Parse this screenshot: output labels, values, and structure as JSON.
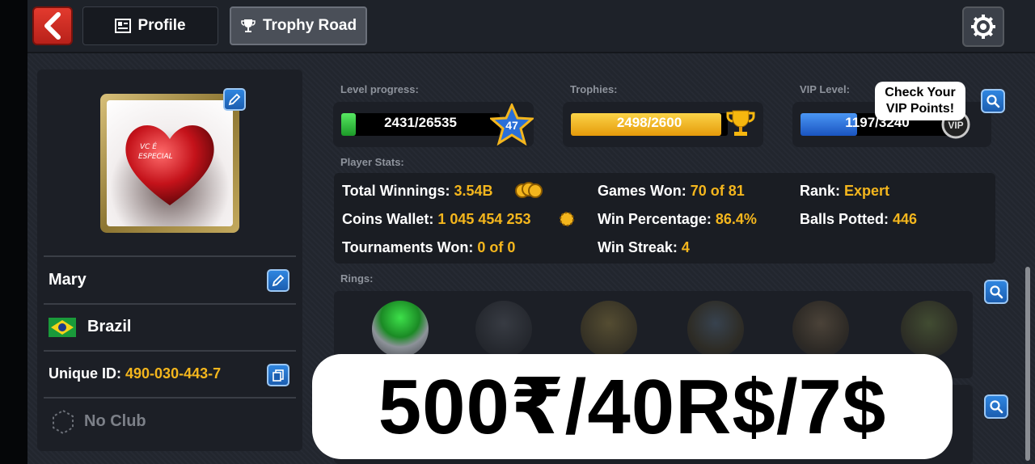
{
  "header": {
    "tabs": [
      {
        "label": "Profile",
        "icon": "id-card-icon"
      },
      {
        "label": "Trophy Road",
        "icon": "trophy-icon"
      }
    ]
  },
  "profile": {
    "name": "Mary",
    "country": "Brazil",
    "unique_id_label": "Unique ID:",
    "unique_id": "490-030-443-7",
    "club": "No Club",
    "avatar_text_line1": "VC É",
    "avatar_text_line2": "ESPECIAL"
  },
  "progress": {
    "level_label": "Level progress:",
    "level_value": "2431/26535",
    "level_fraction": 0.092,
    "level_badge": "47",
    "trophies_label": "Trophies:",
    "trophies_value": "2498/2600",
    "trophies_fraction": 0.96,
    "vip_label": "VIP Level:",
    "vip_value": "1197/3240",
    "vip_fraction": 0.37,
    "vip_badge": "VIP",
    "vip_tooltip_line1": "Check Your",
    "vip_tooltip_line2": "VIP Points!"
  },
  "player_stats": {
    "label": "Player Stats:",
    "total_winnings_label": "Total Winnings:",
    "total_winnings": "3.54B",
    "coins_wallet_label": "Coins Wallet:",
    "coins_wallet": "1 045 454 253",
    "tournaments_won_label": "Tournaments Won:",
    "tournaments_won": "0 of 0",
    "games_won_label": "Games Won:",
    "games_won": "70 of 81",
    "win_percentage_label": "Win Percentage:",
    "win_percentage": "86.4%",
    "win_streak_label": "Win Streak:",
    "win_streak": "4",
    "rank_label": "Rank:",
    "rank": "Expert",
    "balls_potted_label": "Balls Potted:",
    "balls_potted": "446"
  },
  "rings": {
    "label": "Rings:"
  },
  "banner": {
    "price_text": "500₹/40R$/7$"
  },
  "colors": {
    "accent_yellow": "#f4b61d",
    "back_red": "#e23a2e",
    "level_green": "#2fc23a",
    "trophy_gold": "#f6b70f",
    "vip_blue": "#2a74e0"
  }
}
